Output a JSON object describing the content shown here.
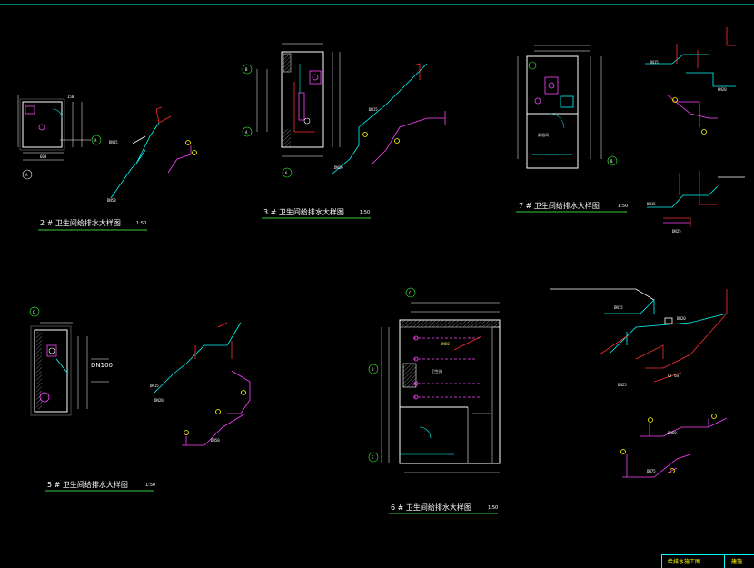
{
  "drawing_titles": {
    "bath_2f": "2 # 卫生间给排水大样图",
    "bath_3f": "3 # 卫生间给排水大样图",
    "bath_7f": "7 # 卫生间给排水大样图",
    "bath_5f": "5 # 卫生间给排水大样图",
    "bath_6f": "6 # 卫生间给排水大样图"
  },
  "scales": {
    "bath_2f": "1:50",
    "bath_3f": "1:50",
    "bath_7f": "1:50",
    "bath_5f": "1:50",
    "bath_6f": "1:50"
  },
  "grid_labels": {
    "b_3f": "B",
    "a_3f": "A",
    "a_2f": "A",
    "b_7f": "B",
    "c_5f": "C",
    "c_6f": "C",
    "d_6f": "D",
    "e_6f": "E"
  },
  "annotations": {
    "dn100": "DN100",
    "room_6f": "卫生间",
    "room_7f": "淋浴间",
    "note_6f": "DN50",
    "pipe_6f": "CT 64"
  },
  "title_block": {
    "left": "给排水施工图",
    "right": "建施"
  },
  "colors": {
    "wall": "#ffffff",
    "cyan": "#00ffff",
    "red": "#ff3030",
    "magenta": "#ff44ff",
    "yellow": "#ffff00",
    "green": "#33ff33",
    "underline": "#33cc33"
  }
}
